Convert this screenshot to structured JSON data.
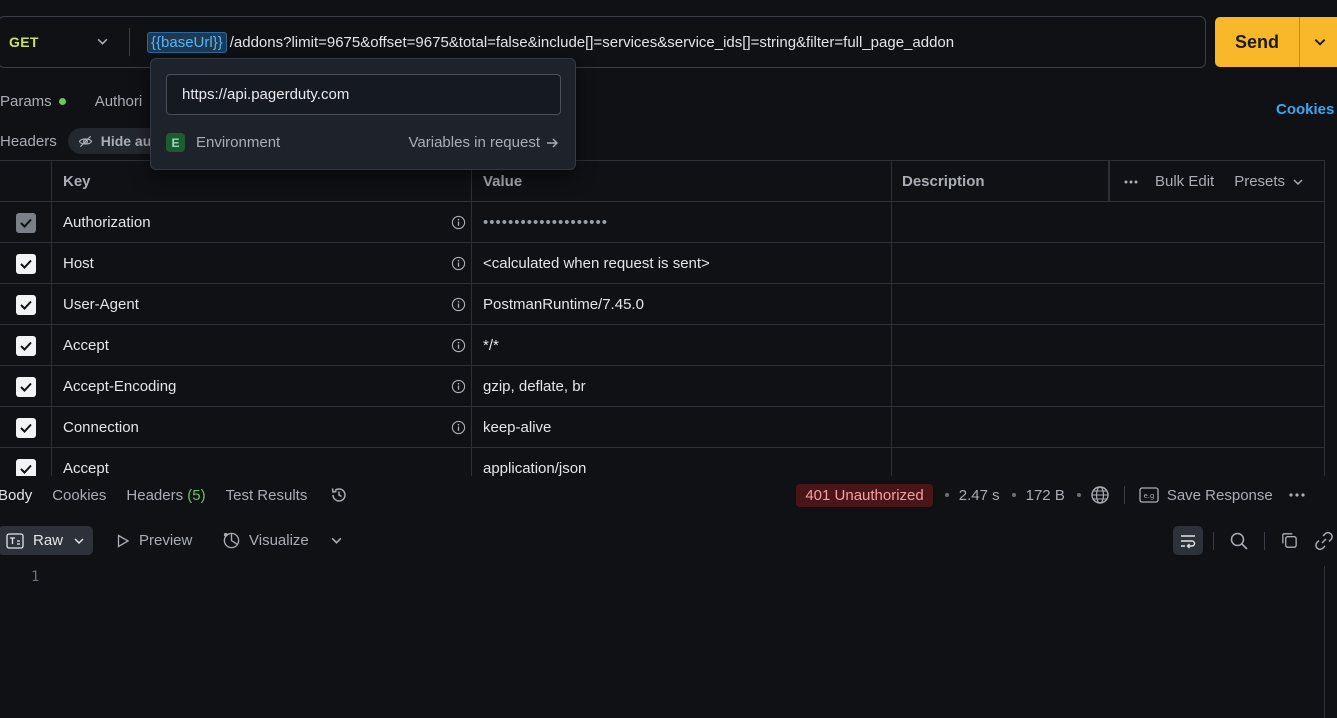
{
  "request": {
    "method": "GET",
    "url_variable": "{{baseUrl}}",
    "url_path": "/addons?limit=9675&offset=9675&total=false&include[]=services&service_ids[]=string&filter=full_page_addon",
    "send_label": "Send"
  },
  "request_tabs": {
    "params": "Params",
    "authorization": "Authori",
    "cookies": "Cookies"
  },
  "headers_section": {
    "label": "Headers",
    "hide_auto": "Hide au"
  },
  "variable_popover": {
    "value": "https://api.pagerduty.com",
    "env_badge": "E",
    "env_label": "Environment",
    "link": "Variables in request"
  },
  "table": {
    "columns": {
      "key": "Key",
      "value": "Value",
      "description": "Description"
    },
    "bulk_edit": "Bulk Edit",
    "presets": "Presets",
    "rows": [
      {
        "key": "Authorization",
        "value": "••••••••••••••••••••"
      },
      {
        "key": "Host",
        "value": "<calculated when request is sent>"
      },
      {
        "key": "User-Agent",
        "value": "PostmanRuntime/7.45.0"
      },
      {
        "key": "Accept",
        "value": "*/*"
      },
      {
        "key": "Accept-Encoding",
        "value": "gzip, deflate, br"
      },
      {
        "key": "Connection",
        "value": "keep-alive"
      },
      {
        "key": "Accept",
        "value": "application/json"
      }
    ]
  },
  "response": {
    "tabs": {
      "body": "Body",
      "cookies": "Cookies",
      "headers": "Headers",
      "headers_count": "(5)",
      "test_results": "Test Results"
    },
    "status": "401 Unauthorized",
    "time": "2.47 s",
    "size": "172 B",
    "save_response": "Save Response",
    "toolbar": {
      "raw": "Raw",
      "preview": "Preview",
      "visualize": "Visualize"
    },
    "line_number": "1"
  },
  "colors": {
    "accent_send": "#f9b82a",
    "method_get": "#c9e266",
    "link_blue": "#3da6f0",
    "status_error_bg": "#4a1518"
  }
}
